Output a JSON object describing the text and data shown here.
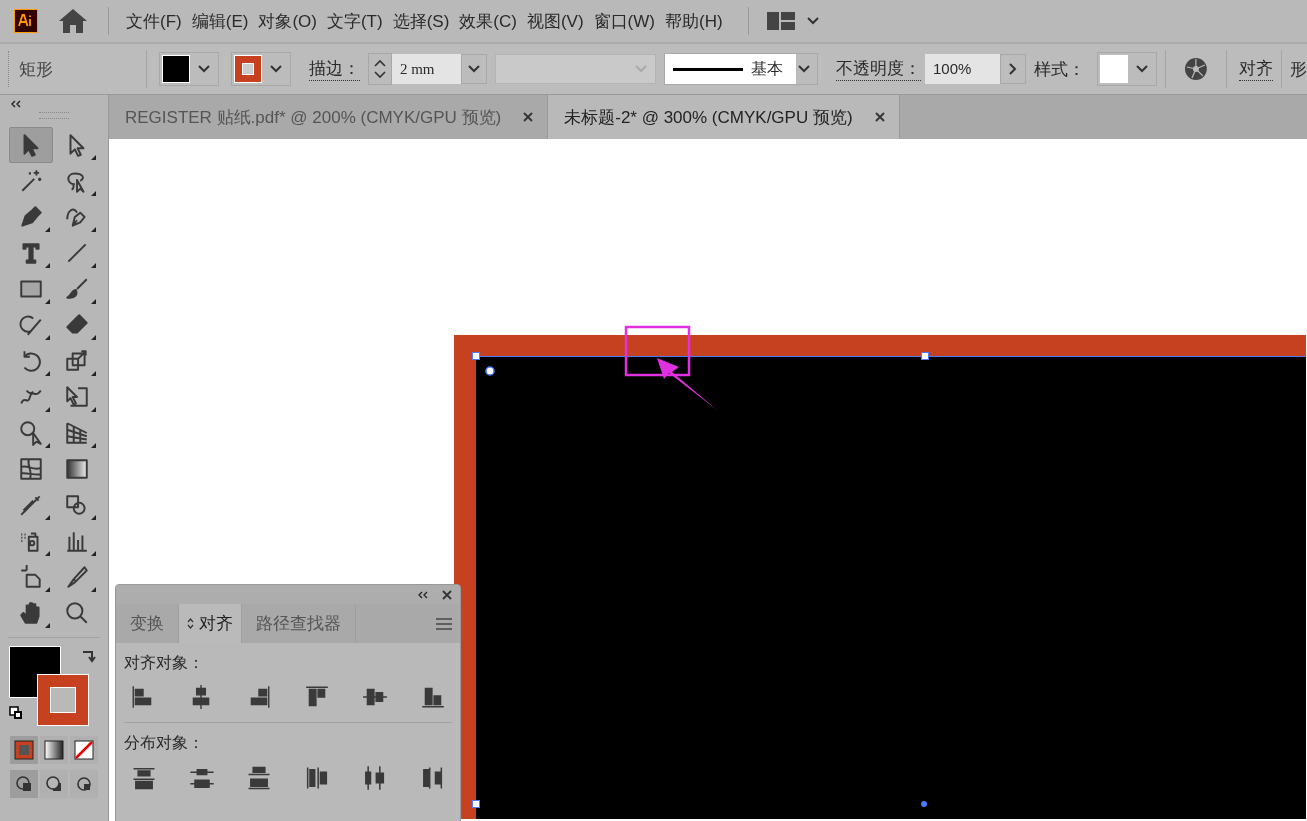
{
  "menu_bar": {
    "items": [
      "文件(F)",
      "编辑(E)",
      "对象(O)",
      "文字(T)",
      "选择(S)",
      "效果(C)",
      "视图(V)",
      "窗口(W)",
      "帮助(H)"
    ]
  },
  "control_bar": {
    "object_type": "矩形",
    "stroke_label": "描边：",
    "stroke_weight": "2 mm",
    "stroke_profile": "基本",
    "opacity_label": "不透明度：",
    "opacity": "100%",
    "style_label": "样式：",
    "align_link": "对齐",
    "shape_link": "形"
  },
  "tabs": [
    {
      "label": "REGISTER 贴纸.pdf* @ 200% (CMYK/GPU 预览)",
      "selected": false
    },
    {
      "label": "未标题-2* @ 300% (CMYK/GPU 预览)",
      "selected": true
    }
  ],
  "toolbox": {
    "tools": [
      {
        "selected": true
      },
      {
        "selected": false
      },
      {
        "selected": false
      },
      {
        "selected": false
      },
      {
        "selected": false
      },
      {
        "selected": false
      },
      {
        "selected": false
      },
      {
        "selected": false
      },
      {
        "selected": false
      },
      {
        "selected": false
      },
      {
        "selected": false
      },
      {
        "selected": false
      },
      {
        "selected": false
      },
      {
        "selected": false
      },
      {
        "selected": false
      },
      {
        "selected": false
      },
      {
        "selected": false
      },
      {
        "selected": false
      },
      {
        "selected": false
      },
      {
        "selected": false
      },
      {
        "selected": false
      },
      {
        "selected": false
      },
      {
        "selected": false
      },
      {
        "selected": false
      },
      {
        "selected": false
      },
      {
        "selected": false
      },
      {
        "selected": false
      },
      {
        "selected": false
      }
    ]
  },
  "align_panel": {
    "tabs": [
      {
        "label": "变换",
        "selected": false
      },
      {
        "label": "对齐",
        "selected": true
      },
      {
        "label": "路径查找器",
        "selected": false
      }
    ],
    "align_objects_label": "对齐对象：",
    "distribute_objects_label": "分布对象："
  }
}
